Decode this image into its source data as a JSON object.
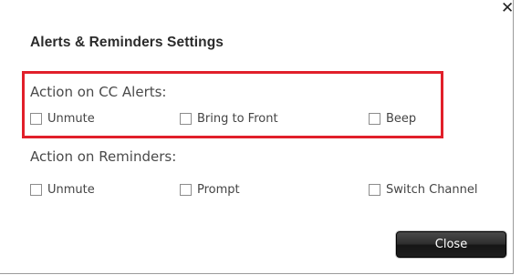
{
  "dialog": {
    "title": "Alerts & Reminders Settings",
    "close_glyph": "✕",
    "close_icon": "close-icon"
  },
  "cc_alerts": {
    "label": "Action on CC Alerts:",
    "options": [
      {
        "label": "Unmute",
        "checked": false
      },
      {
        "label": "Bring to Front",
        "checked": false
      },
      {
        "label": "Beep",
        "checked": false
      }
    ],
    "highlight_color": "#e11f2a"
  },
  "reminders": {
    "label": "Action on Reminders:",
    "options": [
      {
        "label": "Unmute",
        "checked": false
      },
      {
        "label": "Prompt",
        "checked": false
      },
      {
        "label": "Switch Channel",
        "checked": false
      }
    ]
  },
  "footer": {
    "close_label": "Close"
  }
}
